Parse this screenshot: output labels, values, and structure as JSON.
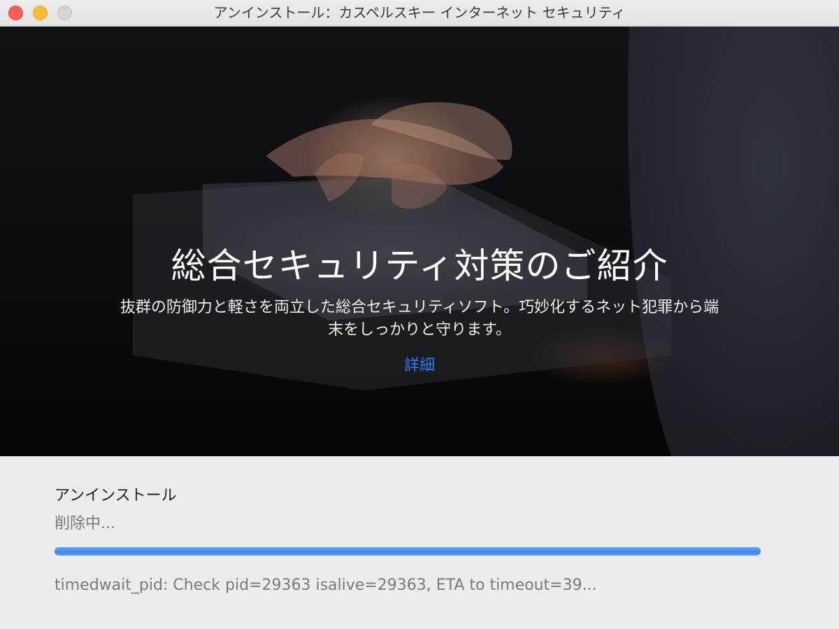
{
  "window": {
    "title": "アンインストール：カスペルスキー インターネット セキュリティ"
  },
  "hero": {
    "heading": "総合セキュリティ対策のご紹介",
    "description_line1": "抜群の防御力と軽さを両立した総合セキュリティソフト。巧妙化するネット犯罪から端",
    "description_line2": "末をしっかりと守ります。",
    "link_label": "詳細",
    "link_color": "#2f7cf6"
  },
  "status": {
    "title": "アンインストール",
    "subtitle": "削除中...",
    "progress_fraction": 1.0,
    "progress_color": "#3c86f0",
    "log": "timedwait_pid: Check pid=29363 isalive=29363, ETA to timeout=39..."
  },
  "colors": {
    "close": "#fe5f57",
    "minimize": "#febc2e",
    "zoom": "#d5d5d5"
  }
}
